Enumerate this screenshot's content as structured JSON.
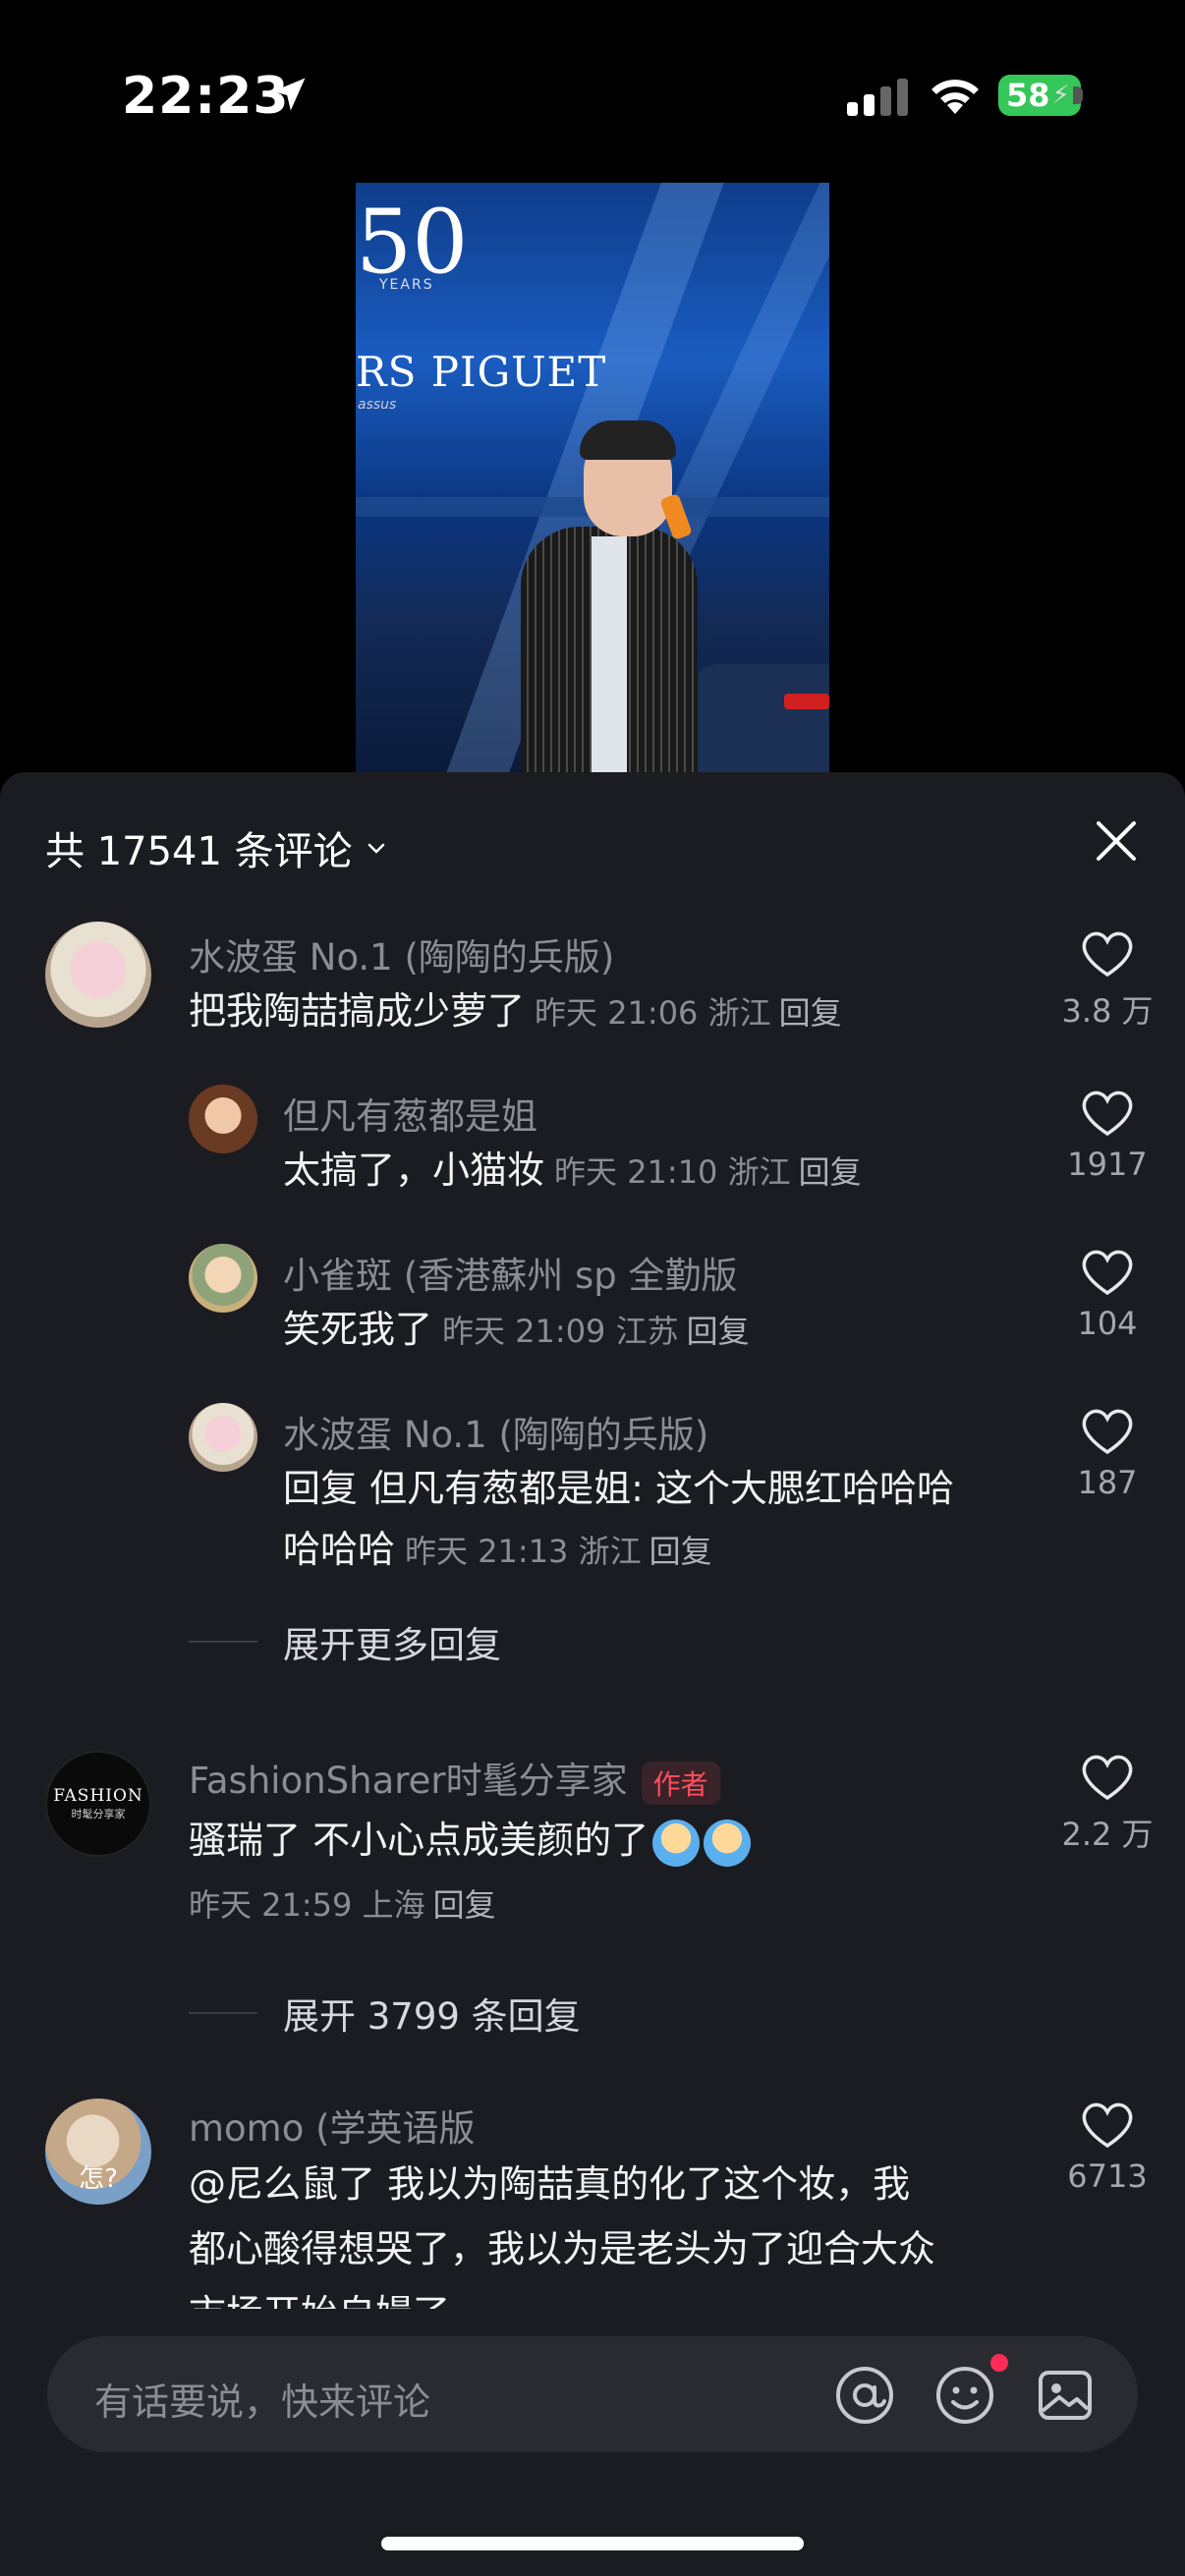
{
  "status_bar": {
    "time": "22:23",
    "battery": "58",
    "battery_color": "#35c759"
  },
  "video": {
    "logo_number": "50",
    "logo_years": "YEARS",
    "brand": "RS PIGUET",
    "brand_sub": "assus"
  },
  "comments_header": {
    "title": "共 17541 条评论"
  },
  "comments": [
    {
      "username": "水波蛋 No.1 (陶陶的兵版)",
      "text": "把我陶喆搞成少萝了",
      "meta": "昨天 21:06 浙江",
      "reply": "回复",
      "likes": "3.8 万",
      "replies": [
        {
          "username": "但凡有葱都是姐",
          "text": "太搞了，小猫妆",
          "meta": "昨天 21:10 浙江",
          "reply": "回复",
          "likes": "1917"
        },
        {
          "username": "小雀斑 (香港蘇州 sp 全勤版",
          "text": "笑死我了",
          "meta": "昨天 21:09 江苏",
          "reply": "回复",
          "likes": "104"
        },
        {
          "username": "水波蛋 No.1 (陶陶的兵版)",
          "text_line1": "回复 但凡有葱都是姐: 这个大腮红哈哈哈",
          "text_line2": "哈哈哈",
          "meta": "昨天 21:13 浙江",
          "reply": "回复",
          "likes": "187"
        }
      ],
      "expand": "展开更多回复"
    },
    {
      "username": "FashionSharer时髦分享家",
      "badge": "作者",
      "avatar_text": "FASHION",
      "avatar_sub": "时髦分享家",
      "text": "骚瑞了  不小心点成美颜的了",
      "meta": "昨天 21:59 上海",
      "reply": "回复",
      "likes": "2.2 万",
      "expand": "展开 3799 条回复"
    },
    {
      "username": "momo (学英语版",
      "avatar_text": "怎?",
      "text_line1": "@尼么鼠了 我以为陶喆真的化了这个妆，我",
      "text_line2": "都心酸得想哭了，我以为是老头为了迎合大众",
      "text_line3": "市场开始自嫚了",
      "likes": "6713"
    }
  ],
  "input": {
    "placeholder": "有话要说，快来评论"
  },
  "colors": {
    "sheet_bg": "#1b1c21",
    "author_badge": "#ff4d5e",
    "notification_dot": "#ff2d55"
  }
}
